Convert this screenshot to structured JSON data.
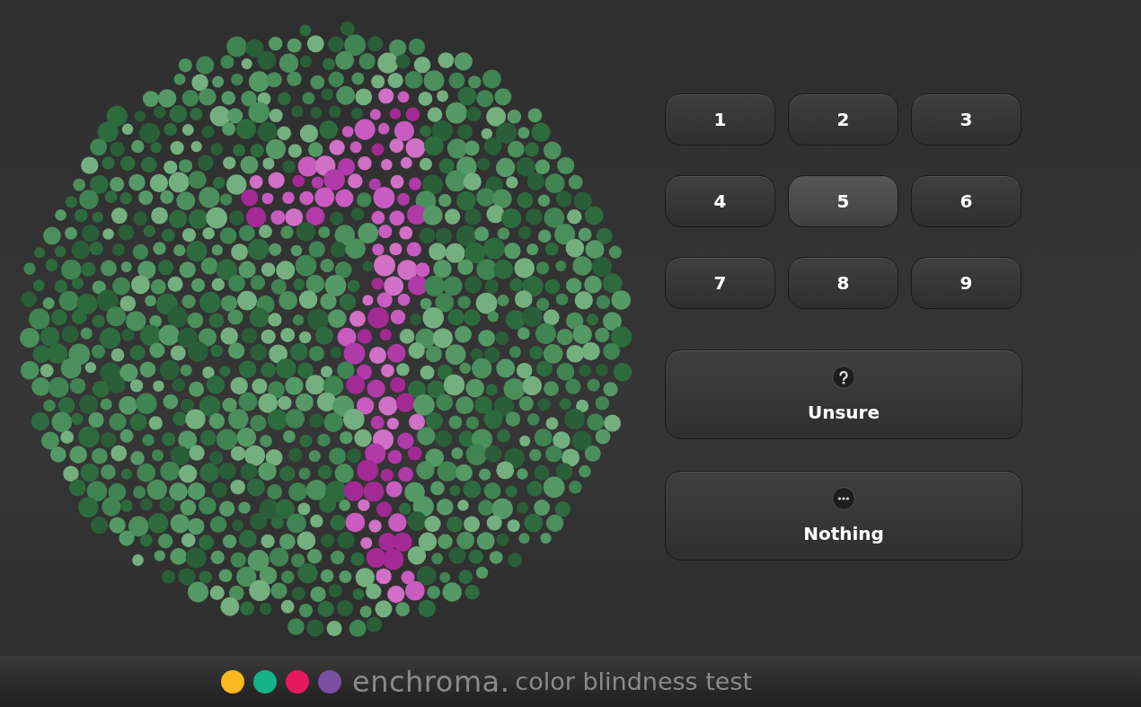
{
  "keypad": [
    {
      "label": "1",
      "selected": false
    },
    {
      "label": "2",
      "selected": false
    },
    {
      "label": "3",
      "selected": false
    },
    {
      "label": "4",
      "selected": false
    },
    {
      "label": "5",
      "selected": true
    },
    {
      "label": "6",
      "selected": false
    },
    {
      "label": "7",
      "selected": false
    },
    {
      "label": "8",
      "selected": false
    },
    {
      "label": "9",
      "selected": false
    }
  ],
  "options": [
    {
      "kind": "unsure",
      "label": "Unsure"
    },
    {
      "kind": "nothing",
      "label": "Nothing"
    }
  ],
  "footer": {
    "dots": [
      {
        "color": "#fbb81f"
      },
      {
        "color": "#14b38a"
      },
      {
        "color": "#e8185f"
      },
      {
        "color": "#7a4fa3"
      }
    ],
    "brand": "enchroma.",
    "tagline": "color blindness test"
  }
}
